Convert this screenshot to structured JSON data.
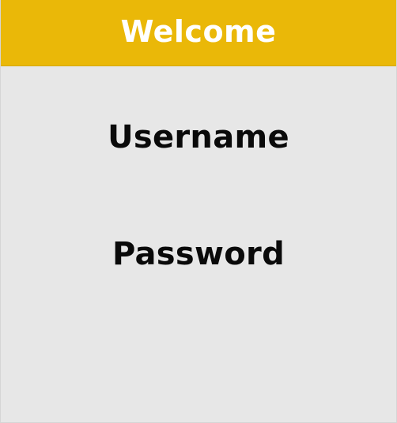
{
  "header": {
    "title": "Welcome",
    "background_color": "#eab808",
    "title_color": "#ffffff"
  },
  "form": {
    "username_label": "Username",
    "password_label": "Password",
    "background_color": "#e7e7e7",
    "label_color": "#0a0a0a"
  }
}
